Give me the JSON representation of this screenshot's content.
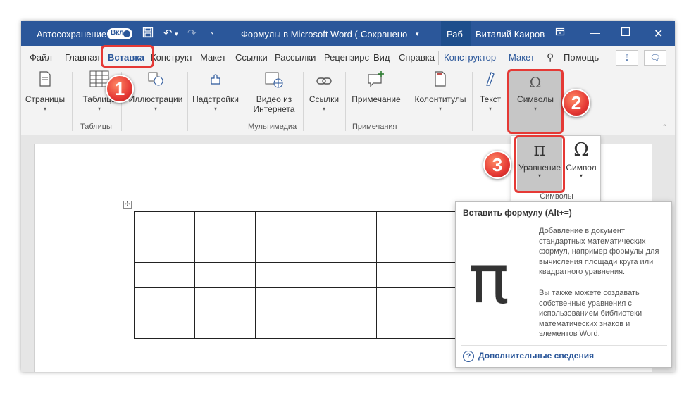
{
  "titlebar": {
    "autosave_label": "Автосохранение",
    "autosave_state": "Вкл.",
    "doc_title": "Формулы в Microsoft Word (...",
    "saved_status": "Сохранено",
    "ribbon_abbrev": "Раб",
    "user_name": "Виталий Каиров",
    "icons": [
      "save-icon",
      "undo-icon",
      "redo-icon",
      "customize-icon",
      "ribbon-display-icon",
      "minimize-icon",
      "maximize-icon",
      "close-icon"
    ]
  },
  "tabs": {
    "file": "Файл",
    "home": "Главная",
    "insert": "Вставка",
    "design": "Конструкт",
    "layout": "Макет",
    "references": "Ссылки",
    "mailings": "Рассылки",
    "review": "Рецензирс",
    "view": "Вид",
    "help": "Справка",
    "table_design": "Конструктор",
    "table_layout": "Макет",
    "search": "Помощь"
  },
  "ribbon": {
    "pages": "Страницы",
    "table": "Таблица",
    "illustrations": "Иллюстрации",
    "addins": "Надстройки",
    "video_line1": "Видео из",
    "video_line2": "Интернета",
    "links": "Ссылки",
    "comment": "Примечание",
    "headers": "Колонтитулы",
    "text": "Текст",
    "symbols": "Символы",
    "groups": {
      "tables": "Таблицы",
      "media": "Мультимедиа",
      "comments": "Примечания"
    }
  },
  "dropdown": {
    "equation": "Уравнение",
    "symbol": "Символ",
    "group": "Символы",
    "equation_glyph": "π",
    "symbol_glyph": "Ω"
  },
  "tooltip": {
    "title": "Вставить формулу (Alt+=)",
    "glyph": "π",
    "description": "Добавление в документ стандартных математических формул, например формулы для вычисления площади круга или квадратного уравнения.",
    "description2": "Вы также можете создавать собственные уравнения с использованием библиотеки математических знаков и элементов Word.",
    "help_link": "Дополнительные сведения"
  },
  "annotations": [
    "1",
    "2",
    "3"
  ],
  "colors": {
    "accent": "#2b579a",
    "highlight": "#e53935"
  }
}
